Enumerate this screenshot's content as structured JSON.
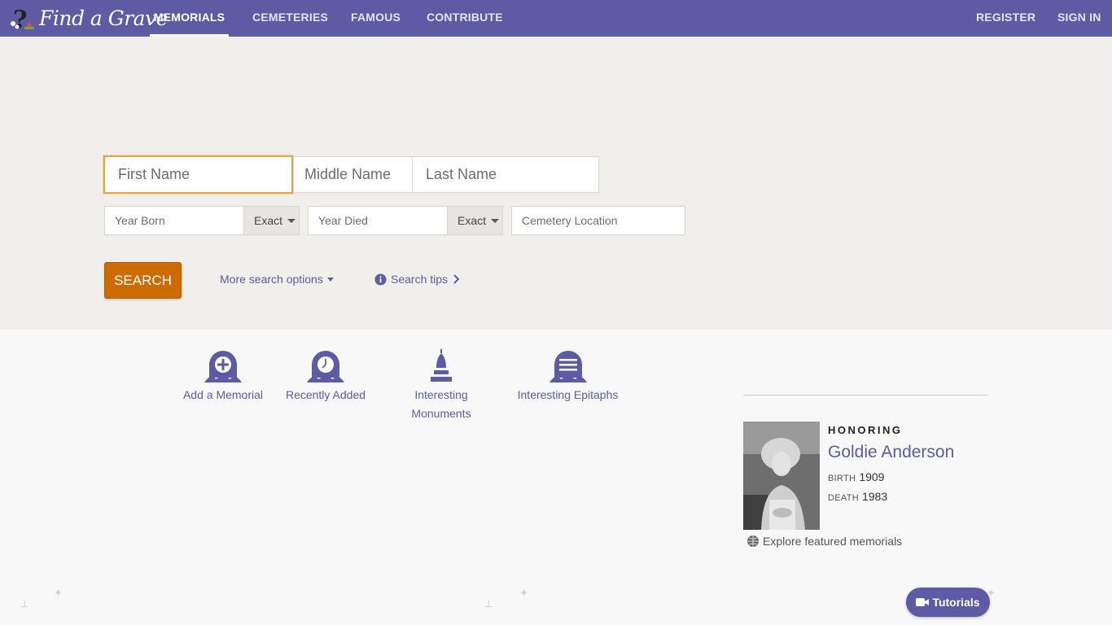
{
  "brand": {
    "name": "Find a Grave"
  },
  "nav": {
    "memorials": "MEMORIALS",
    "cemeteries": "CEMETERIES",
    "famous": "FAMOUS",
    "contribute": "CONTRIBUTE",
    "register": "REGISTER",
    "sign_in": "SIGN IN"
  },
  "search": {
    "first_name_placeholder": "First Name",
    "middle_name_placeholder": "Middle Name",
    "last_name_placeholder": "Last Name",
    "year_born_placeholder": "Year Born",
    "year_born_match": "Exact",
    "year_died_placeholder": "Year Died",
    "year_died_match": "Exact",
    "cemetery_location_placeholder": "Cemetery Location",
    "search_button": "SEARCH",
    "more_options": "More search options",
    "search_tips": "Search tips"
  },
  "tiles": [
    {
      "label": "Add a Memorial",
      "icon": "add-memorial-icon"
    },
    {
      "label": "Recently Added",
      "icon": "clock-headstone-icon"
    },
    {
      "label_line1": "Interesting",
      "label_line2": "Monuments",
      "icon": "monument-icon"
    },
    {
      "label": "Interesting Epitaphs",
      "icon": "epitaph-headstone-icon"
    }
  ],
  "honoring": {
    "label": "HONORING",
    "name": "Goldie Anderson",
    "birth_label": "BIRTH",
    "birth_year": "1909",
    "death_label": "DEATH",
    "death_year": "1983",
    "explore_link": "Explore featured memorials"
  },
  "tutorials_button": "Tutorials",
  "colors": {
    "brand": "#5c5ba3",
    "search_button": "#cc6c00",
    "focus": "#e0a64e"
  }
}
